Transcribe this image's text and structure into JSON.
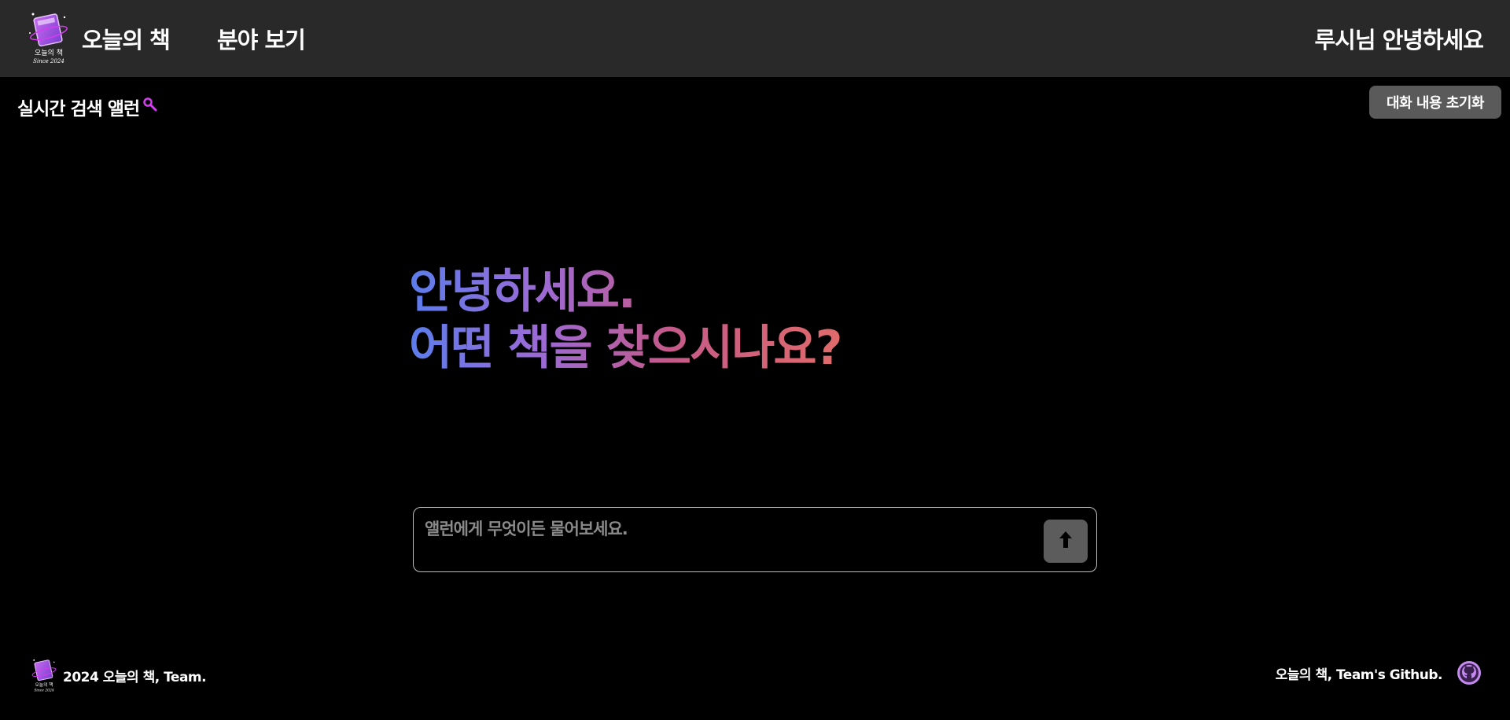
{
  "header": {
    "logo_text": "오늘의 책",
    "logo_since": "Since 2024",
    "nav_home": "오늘의 책",
    "nav_genre": "분야 보기",
    "greeting": "루시님 안녕하세요"
  },
  "realtime": {
    "label": "실시간 검색 앨런",
    "icon": "search-icon"
  },
  "reset_button": "대화 내용 초기화",
  "hero": {
    "line1": "안녕하세요.",
    "line2": "어떤 책을 찾으시나요?"
  },
  "chat": {
    "placeholder": "앨런에게 무엇이든 물어보세요.",
    "send_icon": "arrow-up-icon"
  },
  "footer": {
    "copyright": "2024 오늘의 책, Team.",
    "github_label": "오늘의 책, Team's Github.",
    "github_icon": "github-icon"
  },
  "colors": {
    "header_bg": "#292929",
    "page_bg": "#000000",
    "accent_magenta": "#d63cf0",
    "gradient_start": "#5b7dec",
    "gradient_end": "#e06a6a",
    "button_bg": "#5a5a5a"
  }
}
